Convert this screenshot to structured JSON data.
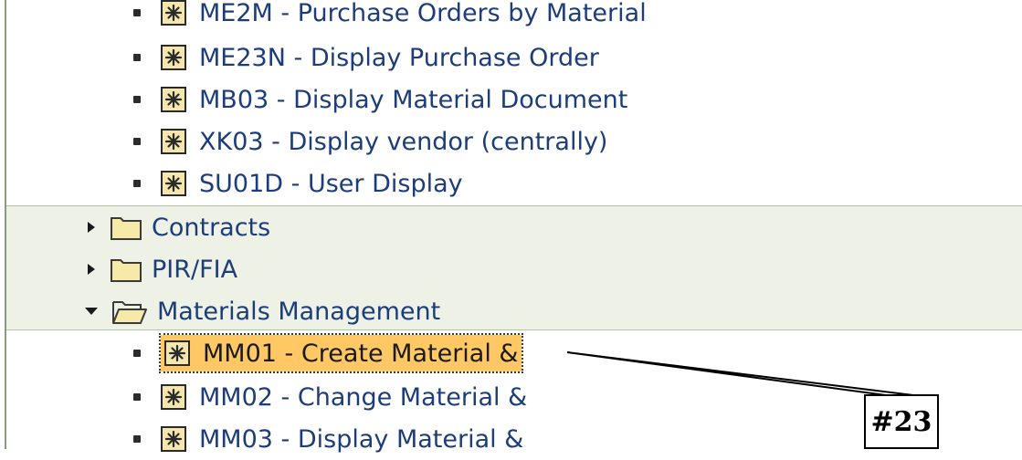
{
  "tree": {
    "transactions_top": [
      {
        "label": "ME2M - Purchase Orders by Material"
      },
      {
        "label": "ME23N - Display Purchase Order"
      },
      {
        "label": "MB03 - Display Material Document"
      },
      {
        "label": "XK03 - Display vendor (centrally)"
      },
      {
        "label": "SU01D - User Display"
      }
    ],
    "folders": [
      {
        "label": "Contracts",
        "state": "collapsed"
      },
      {
        "label": "PIR/FIA",
        "state": "collapsed"
      },
      {
        "label": "Materials Management",
        "state": "expanded"
      }
    ],
    "transactions_mm": [
      {
        "label": "MM01 - Create Material &",
        "selected": true
      },
      {
        "label": "MM02 - Change Material &"
      },
      {
        "label": "MM03 - Display Material &"
      }
    ]
  },
  "callout": {
    "label": "#23"
  },
  "colors": {
    "link_text": "#1c3d7a",
    "selection": "#ffc864",
    "folder_band": "#eef2e6"
  }
}
